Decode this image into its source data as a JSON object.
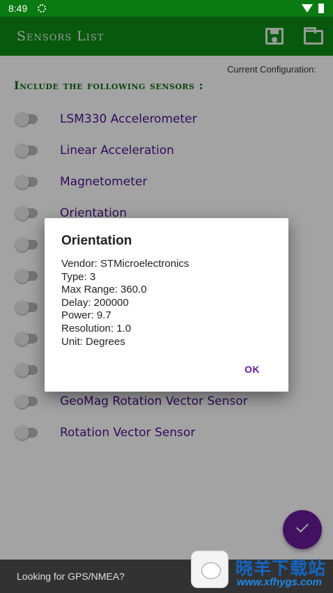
{
  "status_bar": {
    "time": "8:49"
  },
  "app_bar": {
    "title": "Sensors List"
  },
  "config": {
    "label": "Current Configuration:"
  },
  "heading": "Include the following sensors :",
  "sensors": [
    {
      "label": "LSM330 Accelerometer"
    },
    {
      "label": "Linear Acceleration"
    },
    {
      "label": "Magnetometer"
    },
    {
      "label": "Orientation"
    },
    {
      "label": ""
    },
    {
      "label": ""
    },
    {
      "label": ""
    },
    {
      "label": ""
    },
    {
      "label": ""
    },
    {
      "label": "GeoMag Rotation Vector Sensor"
    },
    {
      "label": "Rotation Vector Sensor"
    }
  ],
  "dialog": {
    "title": "Orientation",
    "lines": [
      "Vendor: STMicroelectronics",
      "Type: 3",
      "Max Range: 360.0",
      "Delay: 200000",
      "Power: 9.7",
      "Resolution: 1.0",
      "Unit: Degrees"
    ],
    "ok_label": "OK"
  },
  "snackbar": {
    "text": "Looking for GPS/NMEA?"
  },
  "watermark": {
    "title": "晓羊下载站",
    "url": "www.xfhygs.com"
  },
  "colors": {
    "primary": "#0e8a17",
    "accent": "#6a1b9a",
    "label": "#4a148c"
  }
}
